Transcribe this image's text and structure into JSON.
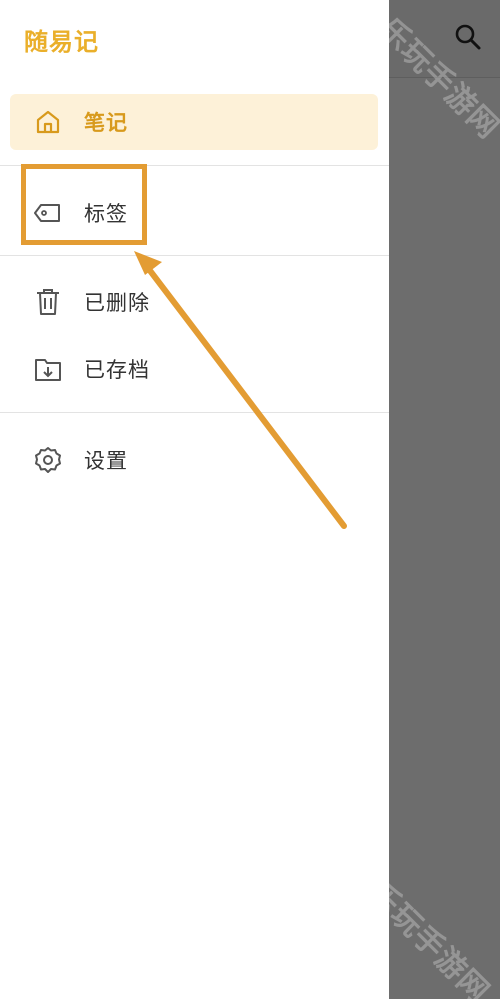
{
  "drawer": {
    "title": "随易记",
    "items": [
      {
        "label": "笔记",
        "icon": "home-icon",
        "active": true
      },
      {
        "label": "标签",
        "icon": "tag-icon",
        "active": false
      },
      {
        "label": "已删除",
        "icon": "trash-icon",
        "active": false
      },
      {
        "label": "已存档",
        "icon": "archive-icon",
        "active": false
      },
      {
        "label": "设置",
        "icon": "gear-icon",
        "active": false
      }
    ]
  },
  "watermark": "乐玩手游网",
  "colors": {
    "accent": "#eaaf2a",
    "active_bg": "#fdf1d8",
    "annotation": "#e39c33",
    "scrim": "#6d6d6d"
  }
}
